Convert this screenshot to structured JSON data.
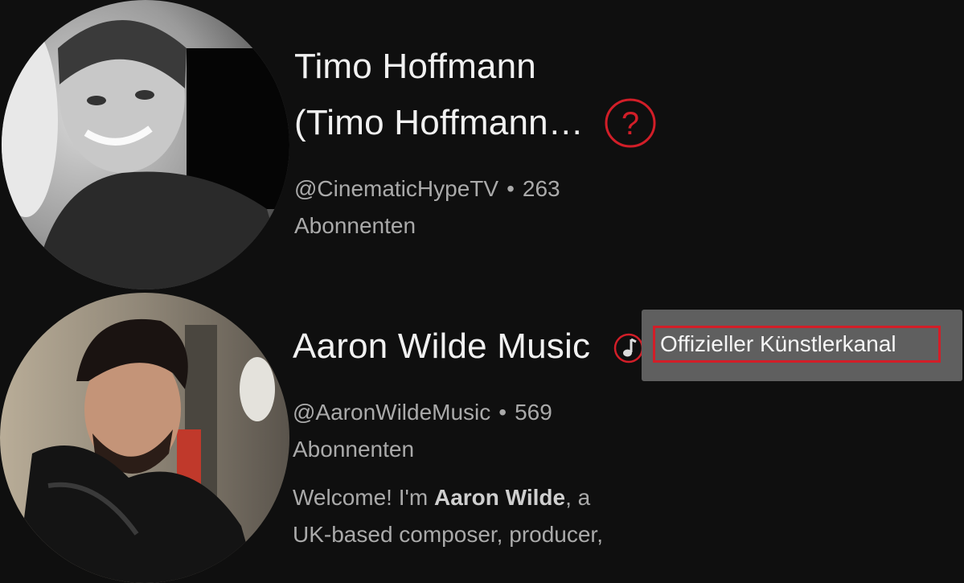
{
  "channels": [
    {
      "title_line1": "Timo Hoffmann",
      "title_line2": "(Timo Hoffmann…",
      "handle": "@CinematicHypeTV",
      "separator": "•",
      "subscribers": "263",
      "subscribers_label": "Abonnenten",
      "badge_icon": "question-mark-icon"
    },
    {
      "title": "Aaron Wilde Music",
      "handle": "@AaronWildeMusic",
      "separator": "•",
      "subscribers": "569",
      "subscribers_label": "Abonnenten",
      "badge_icon": "music-note-icon",
      "description_prefix": "Welcome! I'm ",
      "description_bold": "Aaron Wilde",
      "description_suffix": ", a",
      "description_line2": "UK-based composer, producer,"
    }
  ],
  "tooltip": {
    "text": "Offizieller Künstlerkanal"
  },
  "colors": {
    "background": "#0f0f0f",
    "annotation_red": "#d21e28",
    "tooltip_bg": "#5f5f5f",
    "secondary_text": "#aaaaaa"
  }
}
